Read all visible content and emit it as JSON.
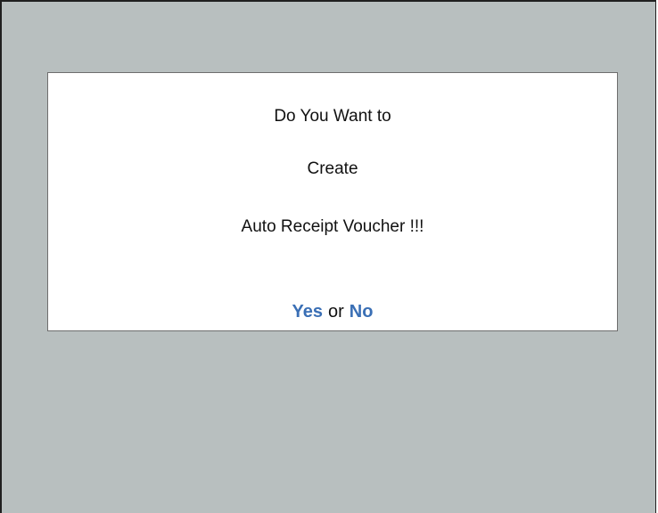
{
  "dialog": {
    "line1": "Do You Want to",
    "line2": "Create",
    "line3": "Auto Receipt Voucher !!!",
    "yes_label": "Yes",
    "or_label": "or",
    "no_label": "No"
  },
  "colors": {
    "background": "#b8bfbf",
    "dialog_bg": "#ffffff",
    "option_text": "#3a6fb5"
  }
}
